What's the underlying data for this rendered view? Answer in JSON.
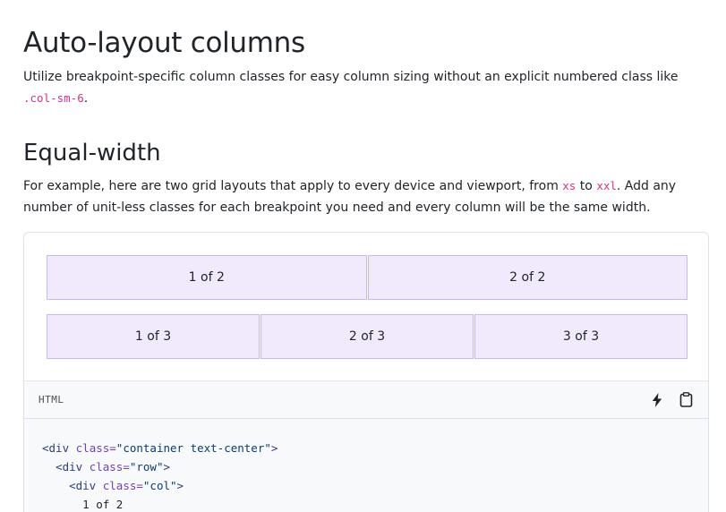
{
  "heading": "Auto-layout columns",
  "intro": {
    "text": "Utilize breakpoint-specific column classes for easy column sizing without an explicit numbered class like ",
    "code": ".col-sm-6",
    "end": "."
  },
  "subheading": "Equal-width",
  "paragraph": {
    "part1": "For example, here are two grid layouts that apply to every device and viewport, from ",
    "code1": "xs",
    "part2": " to ",
    "code2": "xxl",
    "part3": ". Add any number of unit-less classes for each breakpoint you need and every column will be the same width."
  },
  "example": {
    "row1": [
      "1 of 2",
      "2 of 2"
    ],
    "row2": [
      "1 of 3",
      "2 of 3",
      "3 of 3"
    ]
  },
  "codebar": {
    "label": "HTML",
    "tools": [
      "lightning-icon",
      "clipboard-icon"
    ]
  },
  "code": {
    "line1": {
      "indent": "",
      "tag_open": "<div ",
      "attr": "class=",
      "value": "\"container text-center\"",
      "tag_close": ">"
    },
    "line2": {
      "indent": "  ",
      "tag_open": "<div ",
      "attr": "class=",
      "value": "\"row\"",
      "tag_close": ">"
    },
    "line3": {
      "indent": "    ",
      "tag_open": "<div ",
      "attr": "class=",
      "value": "\"col\"",
      "tag_close": ">"
    },
    "line4": {
      "indent": "      ",
      "text": "1 of 2"
    }
  }
}
